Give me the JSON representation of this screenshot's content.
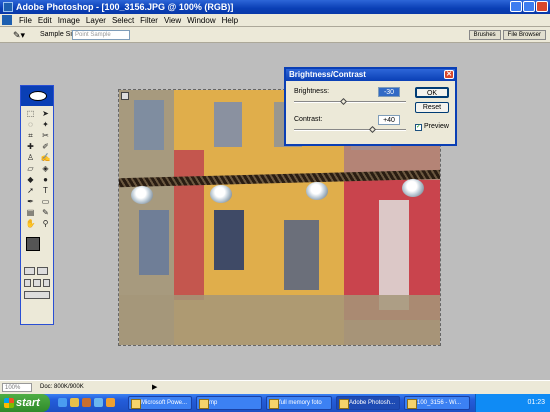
{
  "window": {
    "title": "Adobe Photoshop - [100_3156.JPG @ 100% (RGB)]"
  },
  "menu": [
    "File",
    "Edit",
    "Image",
    "Layer",
    "Select",
    "Filter",
    "View",
    "Window",
    "Help"
  ],
  "options": {
    "sample_label": "Sample Size:",
    "sample_value": "Point Sample",
    "tabs": [
      "Brushes",
      "File Browser"
    ]
  },
  "dialog": {
    "title": "Brightness/Contrast",
    "brightness_label": "Brightness:",
    "brightness_value": "-30",
    "contrast_label": "Contrast:",
    "contrast_value": "+40",
    "ok_label": "OK",
    "reset_label": "Reset",
    "preview_label": "Preview",
    "preview_checked": true
  },
  "status": {
    "zoom": "100%",
    "doc": "Doc: 800K/900K"
  },
  "taskbar": {
    "start_label": "start",
    "tasks": [
      "Microsoft Powe...",
      "mp",
      "full memory foto",
      "Adobe Photosh...",
      "100_3156 - Wi..."
    ],
    "clock": "01:23"
  },
  "colors": {
    "accent": "#0a3fb5",
    "taskbar": "#245edb",
    "start": "#2f8a2a"
  }
}
